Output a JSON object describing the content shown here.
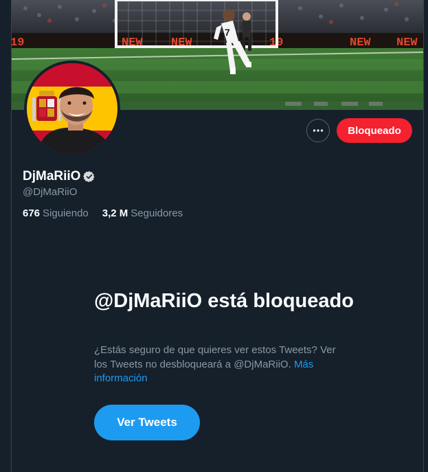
{
  "profile": {
    "display_name": "DjMaRiiO",
    "handle": "@DjMaRiiO",
    "following_count": "676",
    "following_label": "Siguiendo",
    "followers_count": "3,2 M",
    "followers_label": "Seguidores"
  },
  "banner": {
    "player_number": "7",
    "board_text": "NEW NEW",
    "board_number": "19"
  },
  "actions": {
    "more_icon": "more-horizontal-icon",
    "blocked_label": "Bloqueado"
  },
  "blocked_notice": {
    "title": "@DjMaRiiO está bloqueado",
    "description": "¿Estás seguro de que quieres ver estos Tweets? Ver los Tweets no desbloqueará a @DjMaRiiO.",
    "more_link": "Más información",
    "view_button": "Ver Tweets"
  },
  "colors": {
    "background": "#15202b",
    "accent": "#1d9bf0",
    "blocked": "#f4212e",
    "secondary_text": "#8b98a5"
  }
}
